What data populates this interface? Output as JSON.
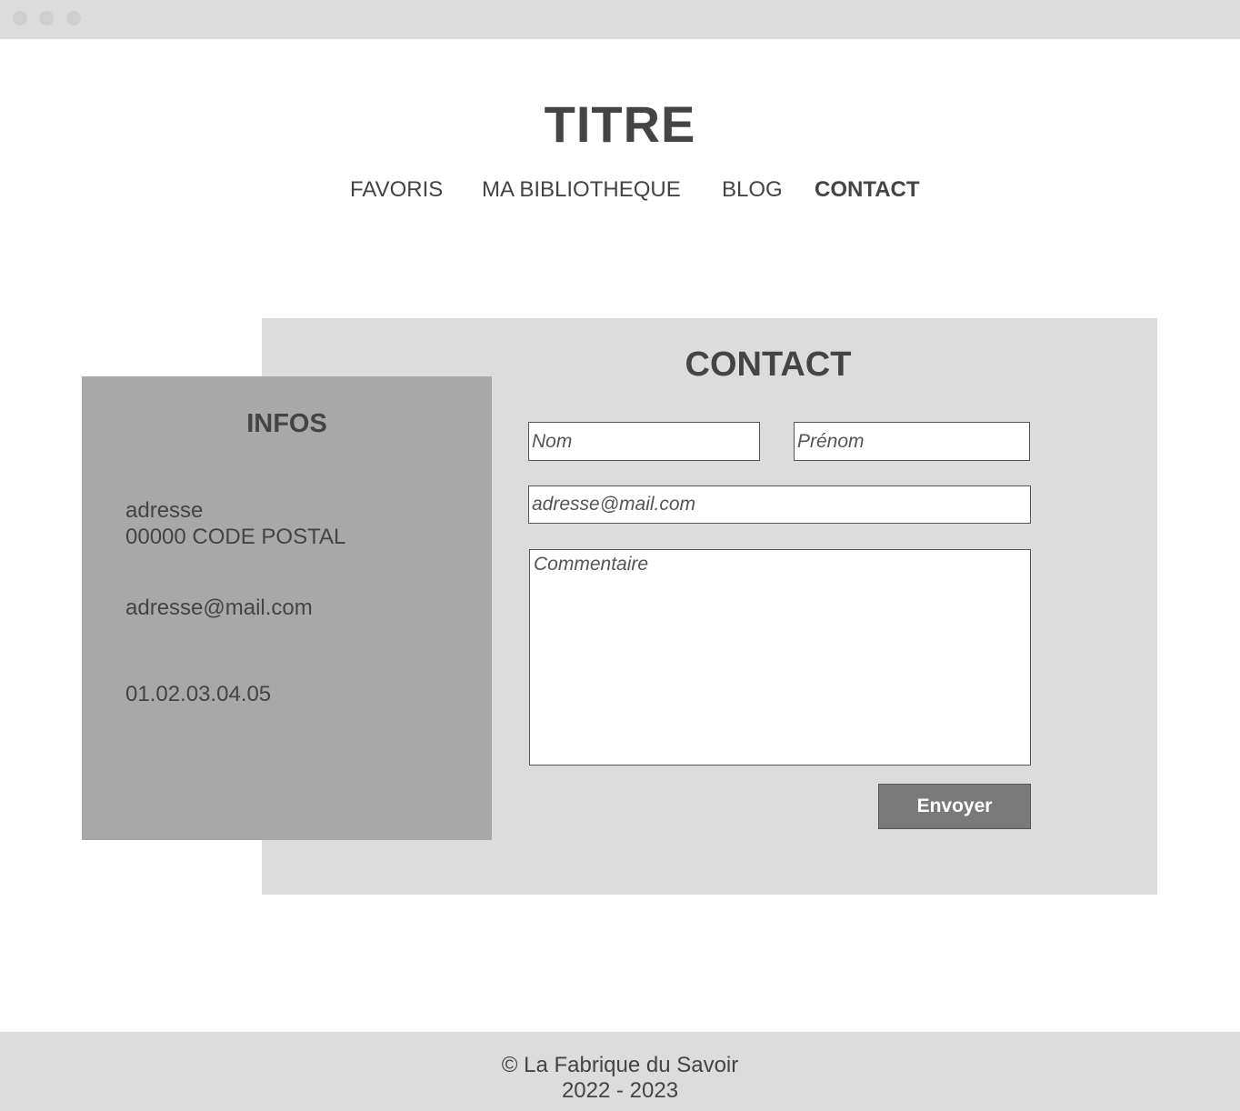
{
  "header": {
    "title": "TITRE",
    "nav": [
      {
        "label": "FAVORIS"
      },
      {
        "label": "MA BIBLIOTHEQUE"
      },
      {
        "label": "BLOG"
      },
      {
        "label": "CONTACT",
        "active": true
      }
    ]
  },
  "contact": {
    "title": "CONTACT",
    "form": {
      "nom_placeholder": "Nom",
      "prenom_placeholder": "Prénom",
      "email_placeholder": "adresse@mail.com",
      "comment_placeholder": "Commentaire",
      "submit_label": "Envoyer"
    }
  },
  "infos": {
    "title": "INFOS",
    "address_line1": "adresse",
    "address_line2": "00000 CODE POSTAL",
    "email": "adresse@mail.com",
    "phone": "01.02.03.04.05"
  },
  "footer": {
    "copyright": "© La Fabrique du Savoir",
    "years": "2022 - 2023"
  },
  "colors": {
    "panel_light": "#dcdcdc",
    "panel_dark": "#a8a8a8",
    "text": "#444444",
    "button": "#7a7a7a"
  }
}
